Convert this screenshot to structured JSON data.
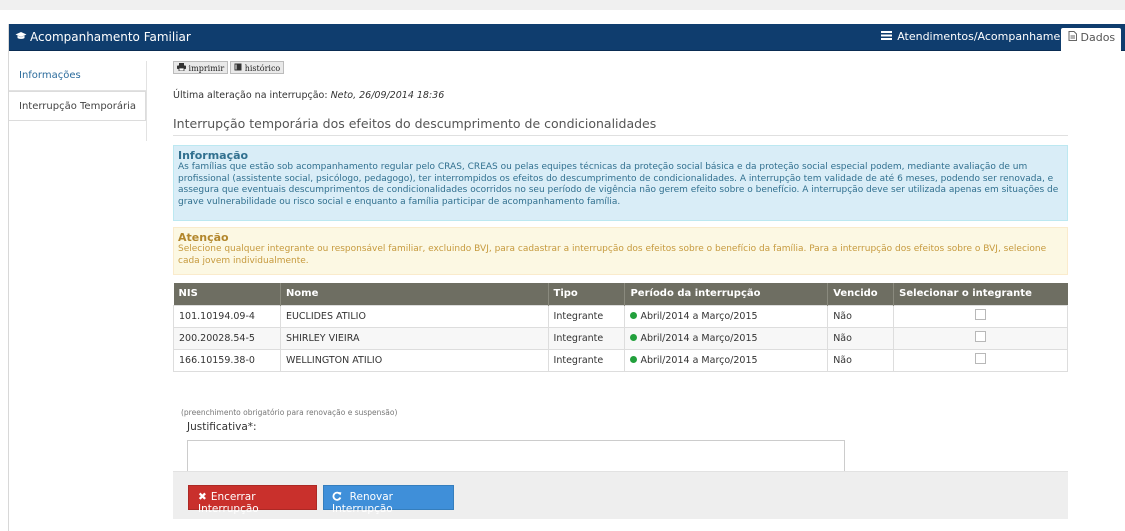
{
  "header": {
    "title": "Acompanhamento Familiar",
    "title_icon": "graduation-cap-icon",
    "tab_atendimentos": "Atendimentos/Acompanhamentos",
    "tab_atendimentos_icon": "list-icon",
    "tab_dados": "Dados",
    "tab_dados_icon": "document-icon"
  },
  "sidebar": {
    "items": [
      {
        "label": "Informações"
      },
      {
        "label": "Interrupção Temporária"
      }
    ]
  },
  "toolbar": {
    "print_label": "imprimir",
    "history_label": "histórico"
  },
  "last_change": {
    "label": "Última alteração na interrupção:",
    "value": "Neto, 26/09/2014 18:36"
  },
  "section_title": "Interrupção temporária dos efeitos do descumprimento de condicionalidades",
  "info_alert": {
    "heading": "Informação",
    "text": "As famílias que estão sob acompanhamento regular pelo CRAS, CREAS ou pelas equipes técnicas da proteção social básica e da proteção social especial podem, mediante avaliação de um profissional (assistente social, psicólogo, pedagogo), ter interrompidos os efeitos do descumprimento de condicionalidades. A interrupção tem validade de até 6 meses, podendo ser renovada, e assegura que eventuais descumprimentos de condicionalidades ocorridos no seu período de vigência não gerem efeito sobre o benefício. A interrupção deve ser utilizada apenas em situações de grave vulnerabilidade ou risco social e enquanto a família participar de acompanhamento família."
  },
  "warn_alert": {
    "heading": "Atenção",
    "text": "Selecione qualquer integrante ou responsável familiar, excluindo BVJ, para cadastrar a interrupção dos efeitos sobre o benefício da família. Para a interrupção dos efeitos sobre o BVJ, selecione cada jovem individualmente."
  },
  "table": {
    "headers": [
      "NIS",
      "Nome",
      "Tipo",
      "Período da interrupção",
      "Vencido",
      "Selecionar o integrante"
    ],
    "rows": [
      {
        "nis": "101.10194.09-4",
        "nome": "EUCLIDES ATILIO",
        "tipo": "Integrante",
        "periodo": "Abril/2014 a Março/2015",
        "vencido": "Não"
      },
      {
        "nis": "200.20028.54-5",
        "nome": "SHIRLEY VIEIRA",
        "tipo": "Integrante",
        "periodo": "Abril/2014 a Março/2015",
        "vencido": "Não"
      },
      {
        "nis": "166.10159.38-0",
        "nome": "WELLINGTON ATILIO",
        "tipo": "Integrante",
        "periodo": "Abril/2014 a Março/2015",
        "vencido": "Não"
      }
    ]
  },
  "form": {
    "hint": "(preenchimento obrigatório para renovação e suspensão)",
    "label": "Justificativa*:",
    "value": ""
  },
  "footer": {
    "end_label": "Encerrar Interrupção",
    "renew_label": "Renovar Interrupção"
  },
  "colors": {
    "header_bg": "#0f3d6e",
    "table_header_bg": "#6e6e62",
    "status_active": "#22a03c",
    "btn_danger": "#c9302c",
    "btn_primary": "#3f8fd9"
  }
}
